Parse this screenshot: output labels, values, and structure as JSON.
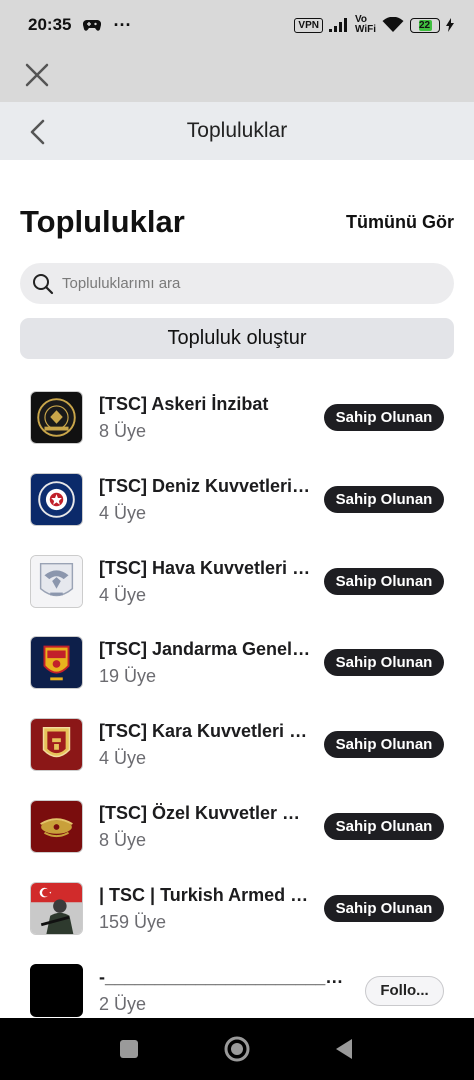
{
  "status_bar": {
    "time": "20:35",
    "dots": "···",
    "vpn": "VPN",
    "vowifi_top": "Vo",
    "vowifi_bottom": "WiFi",
    "battery": "22"
  },
  "nav": {
    "title": "Topluluklar"
  },
  "header": {
    "title": "Topluluklar",
    "see_all": "Tümünü Gör"
  },
  "search": {
    "placeholder": "Topluluklarımı ara"
  },
  "create_button": "Topluluk oluştur",
  "communities": [
    {
      "name": "[TSC] Askeri İnzibat",
      "members": "8 Üye",
      "badge": "Sahip Olunan",
      "icon": "askeri-inzibat-logo"
    },
    {
      "name": "[TSC] Deniz Kuvvetleri Komutanlığı",
      "members": "4 Üye",
      "badge": "Sahip Olunan",
      "icon": "deniz-kuvvetleri-logo"
    },
    {
      "name": "[TSC] Hava Kuvvetleri Komutanlığı",
      "members": "4 Üye",
      "badge": "Sahip Olunan",
      "icon": "hava-kuvvetleri-logo"
    },
    {
      "name": "[TSC] Jandarma Genel Komutanlığı",
      "members": "19 Üye",
      "badge": "Sahip Olunan",
      "icon": "jandarma-logo"
    },
    {
      "name": "[TSC] Kara Kuvvetleri Komutanlığı",
      "members": "4 Üye",
      "badge": "Sahip Olunan",
      "icon": "kara-kuvvetleri-logo"
    },
    {
      "name": "[TSC] Özel Kuvvetler Komutanlığı",
      "members": "8 Üye",
      "badge": "Sahip Olunan",
      "icon": "ozel-kuvvetler-logo"
    },
    {
      "name": "| TSC | Turkish Armed Forces",
      "members": "159 Üye",
      "badge": "Sahip Olunan",
      "icon": "soldier-photo"
    },
    {
      "name": "-_________________________",
      "members": "2 Üye",
      "follow": "Follo...",
      "icon": "black-square"
    }
  ]
}
